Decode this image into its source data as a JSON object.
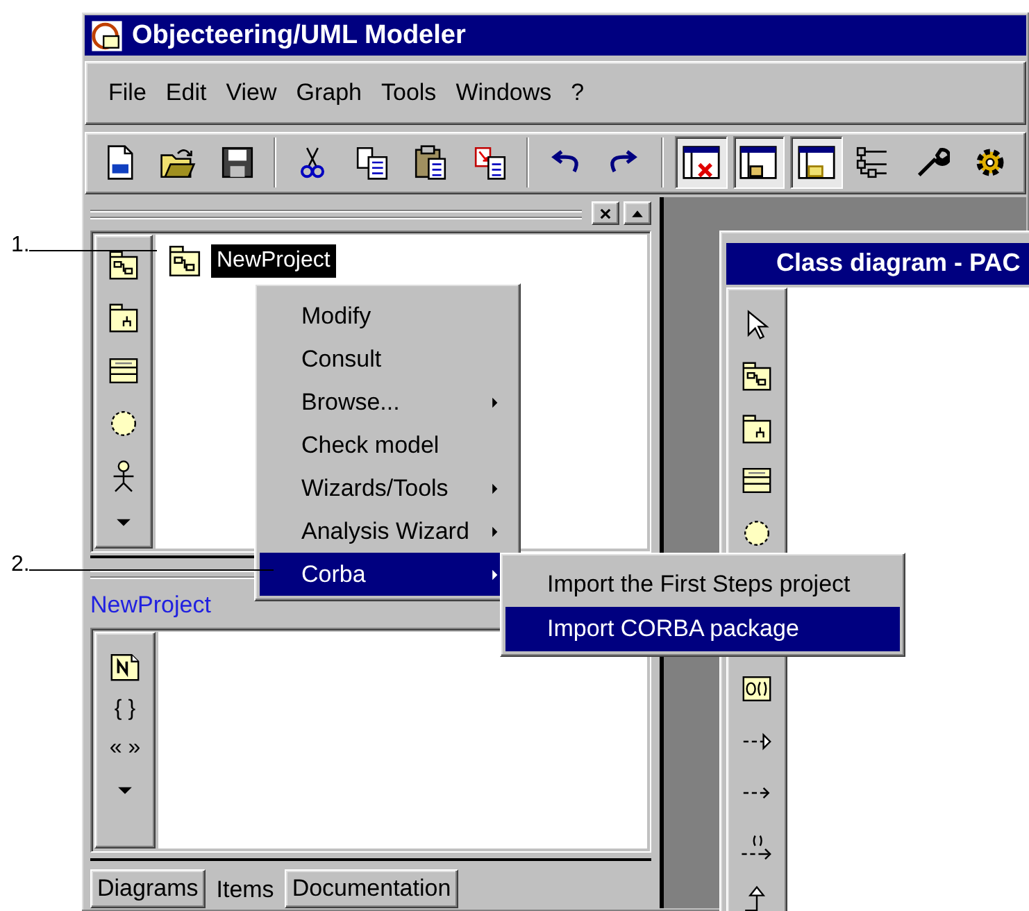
{
  "window": {
    "title": "Objecteering/UML Modeler"
  },
  "menu_bar": [
    {
      "label": "File"
    },
    {
      "label": "Edit"
    },
    {
      "label": "View"
    },
    {
      "label": "Graph"
    },
    {
      "label": "Tools"
    },
    {
      "label": "Windows"
    },
    {
      "label": "?"
    }
  ],
  "toolbar": {
    "view_toggles": [
      {
        "on": true
      },
      {
        "on": true
      },
      {
        "on": true
      }
    ]
  },
  "explorer": {
    "tree": [
      {
        "label": "NewProject",
        "selected": true
      }
    ]
  },
  "items_panel": {
    "title": "NewProject",
    "palette_glyphs": [
      "{ }",
      "« »"
    ]
  },
  "tabs": [
    {
      "label": "Diagrams",
      "selected": false
    },
    {
      "label": "Items",
      "selected": true
    },
    {
      "label": "Documentation",
      "selected": false
    }
  ],
  "diagram_window": {
    "title": "Class diagram - PAC"
  },
  "context_menu": [
    {
      "label": "Modify",
      "submenu": false,
      "selected": false
    },
    {
      "label": "Consult",
      "submenu": false,
      "selected": false
    },
    {
      "label": "Browse...",
      "submenu": true,
      "selected": false
    },
    {
      "label": "Check model",
      "submenu": false,
      "selected": false
    },
    {
      "label": "Wizards/Tools",
      "submenu": true,
      "selected": false
    },
    {
      "label": "Analysis Wizard",
      "submenu": true,
      "selected": false
    },
    {
      "label": "Corba",
      "submenu": true,
      "selected": true
    }
  ],
  "submenu": [
    {
      "label": "Import the First Steps project",
      "selected": false
    },
    {
      "label": "Import CORBA package",
      "selected": true
    }
  ],
  "annotations": [
    {
      "label": "1."
    },
    {
      "label": "2."
    }
  ]
}
